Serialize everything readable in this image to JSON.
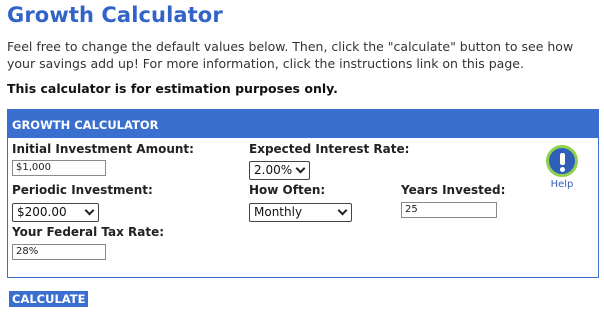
{
  "page": {
    "title": "Growth Calculator",
    "intro": "Feel free to change the default values below. Then, click the \"calculate\" button to see how your savings add up! For more information, click the instructions link on this page.",
    "disclaimer": "This calculator is for estimation purposes only."
  },
  "calculator": {
    "header": "GROWTH CALCULATOR",
    "initial_investment": {
      "label": "Initial Investment Amount:",
      "value": "$1,000"
    },
    "interest_rate": {
      "label": "Expected Interest Rate:",
      "value": "2.00%"
    },
    "periodic_investment": {
      "label": "Periodic Investment:",
      "value": "$200.00"
    },
    "how_often": {
      "label": "How Often:",
      "value": "Monthly"
    },
    "years_invested": {
      "label": "Years Invested:",
      "value": "25"
    },
    "tax_rate": {
      "label": "Your Federal Tax Rate:",
      "value": "28%"
    },
    "help": {
      "label": "Help",
      "icon": "exclamation-icon"
    }
  },
  "actions": {
    "calculate_label": "CALCULATE"
  },
  "colors": {
    "accent": "#3a6fd0",
    "title": "#3263c8",
    "help_ring": "#8fd14f"
  }
}
